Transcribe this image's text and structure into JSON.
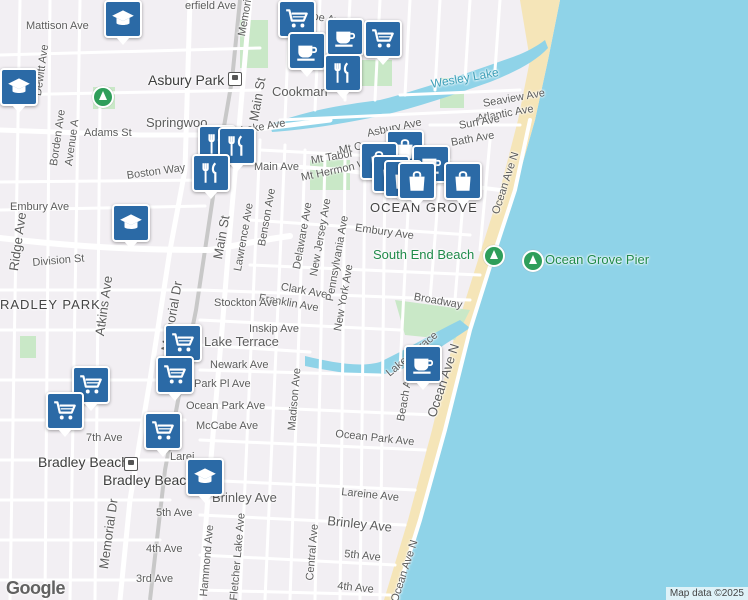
{
  "map": {
    "attribution": "Map data ©2025",
    "logo": "Google",
    "colors": {
      "land": "#f2eff3",
      "water": "#8fd3e8",
      "beach": "#f5e5b8",
      "park": "#c9e8c7",
      "road": "#ffffff",
      "major_road": "#ffffff",
      "railway": "#bdbdbd",
      "poi_marker": "#2b6aa6"
    },
    "places": {
      "asbury_park": "Asbury Park",
      "ocean_grove": "OCEAN GROVE",
      "bradley_park": "RADLEY PARK",
      "bradley_beach": "Bradley Beach"
    },
    "water_labels": {
      "wesley_lake": "Wesley Lake"
    },
    "green_labels": {
      "south_end_beach": "South End Beach",
      "ocean_grove_pier": "Ocean Grove Pier"
    },
    "streets": {
      "mattison_ave": "Mattison Ave",
      "bergfield": "erfield Ave",
      "springwood": "Springwoo",
      "cookman": "Cookman",
      "adams_st": "Adams St",
      "boston_way": "Boston Way",
      "embury_ave_w": "Embury Ave",
      "division_st": "Division St",
      "main_ave": "Main Ave",
      "main_st": "Main St",
      "memorial_dr_n": "Memorial Dr",
      "main_st_lower": "Main St",
      "lawrence_ave": "Lawrence Ave",
      "benson_ave": "Benson Ave",
      "delaware_ave": "Delaware Ave",
      "new_jersey_ave": "New Jersey Ave",
      "pennsylvania_ave": "Pennsylvania Ave",
      "new_york_ave": "New York Ave",
      "clark_ave": "Clark Ave",
      "franklin_ave": "Franklin Ave",
      "stockton_ave": "Stockton Ave",
      "inskip_ave": "Inskip Ave",
      "lake_terrace_w": "Lake Terrace",
      "lake_terrace_e": "Lake Terrace",
      "newark_ave": "Newark Ave",
      "park_pl_ave": "Park Pl Ave",
      "ocean_park_ave_w": "Ocean Park Ave",
      "ocean_park_ave_e": "Ocean Park Ave",
      "mccabe_ave": "McCabe Ave",
      "seventh_ave": "7th Ave",
      "lareine_ave_w": "Larei",
      "lareine_ave_e": "Lareine Ave",
      "brinley_ave_w": "Brinley Ave",
      "brinley_ave_e": "Brinley Ave",
      "fifth_ave_w": "5th Ave",
      "fifth_ave_e": "5th Ave",
      "fourth_ave_w": "4th Ave",
      "fourth_ave_e": "4th Ave",
      "third_ave": "3rd Ave",
      "madison_ave": "Madison Ave",
      "central_ave": "Central Ave",
      "fletcher_lake_ave": "Fletcher Lake Ave",
      "hammond_ave": "Hammond Ave",
      "beach_ave": "Beach Ave",
      "ocean_ave_n": "Ocean Ave N",
      "ocean_ave_n2": "Ocean Ave N",
      "ocean_ave_n3": "Ocean Ave N",
      "broadway": "Broadway",
      "embury_ave_e": "Embury Ave",
      "mt_tabor": "Mt Tabor",
      "mt_hermon": "Mt Hermon W",
      "mt_c": "Mt C",
      "asbury_ave": "Asbury Ave",
      "lake_ave": "Lake Ave",
      "seaview_ave": "Seaview Ave",
      "atlantic_ave": "Atlantic Ave",
      "surf_ave": "Surf Ave",
      "bath_ave": "Bath Ave",
      "atkins_ave": "Atkins Ave",
      "ridge_ave": "Ridge Ave",
      "borden_ave": "Borden Ave",
      "avenue_a": "Avenue A",
      "dewitt_ave": "Dewitt Ave",
      "memorial_dr_s": "Memorial Dr",
      "memorial_top": "Memori",
      "roe_ave": "roe Av"
    },
    "pois": [
      {
        "id": "poi-grocery-1",
        "icon": "shopping-cart-icon"
      },
      {
        "id": "poi-school-1",
        "icon": "school-icon"
      },
      {
        "id": "poi-cafe-1",
        "icon": "coffee-cup-icon"
      },
      {
        "id": "poi-cafe-2",
        "icon": "coffee-cup-icon"
      },
      {
        "id": "poi-grocery-2",
        "icon": "shopping-cart-icon"
      },
      {
        "id": "poi-restaurant-1",
        "icon": "fork-knife-icon"
      },
      {
        "id": "poi-school-2",
        "icon": "school-icon"
      },
      {
        "id": "poi-restaurant-2",
        "icon": "fork-knife-icon"
      },
      {
        "id": "poi-restaurant-3",
        "icon": "fork-knife-icon"
      },
      {
        "id": "poi-school-3",
        "icon": "school-icon"
      },
      {
        "id": "poi-shop-1",
        "icon": "shopping-bag-icon"
      },
      {
        "id": "poi-shop-2",
        "icon": "shopping-bag-icon"
      },
      {
        "id": "poi-grocery-3",
        "icon": "shopping-cart-icon"
      },
      {
        "id": "poi-grocery-4",
        "icon": "shopping-cart-icon"
      },
      {
        "id": "poi-grocery-5",
        "icon": "shopping-cart-icon"
      },
      {
        "id": "poi-grocery-6",
        "icon": "shopping-cart-icon"
      },
      {
        "id": "poi-grocery-7",
        "icon": "shopping-cart-icon"
      },
      {
        "id": "poi-cafe-3",
        "icon": "coffee-cup-icon"
      },
      {
        "id": "poi-school-4",
        "icon": "school-icon"
      }
    ]
  }
}
